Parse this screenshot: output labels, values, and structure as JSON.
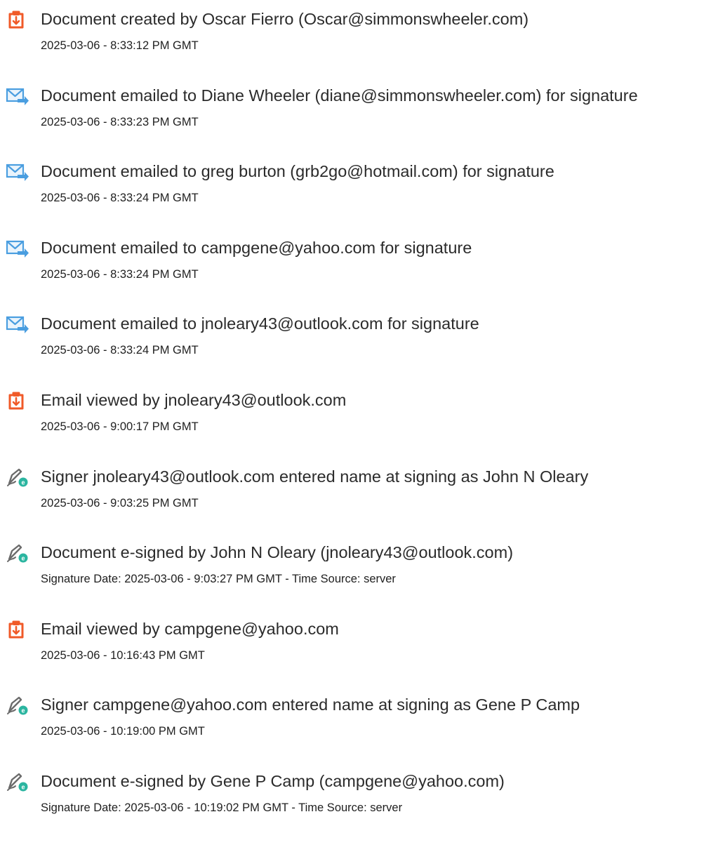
{
  "colors": {
    "created_icon": "#f05a28",
    "emailed_icon": "#4a9ee0",
    "signed_icon_pen": "#6b6b6b",
    "signed_icon_badge": "#2bb5a0",
    "text_primary": "#2b2b2b",
    "text_secondary": "#1f1f1f"
  },
  "events": [
    {
      "icon": "document-icon",
      "text": "Document created by Oscar Fierro (Oscar@simmonswheeler.com)",
      "detail": "2025-03-06 - 8:33:12 PM GMT"
    },
    {
      "icon": "email-icon",
      "text": "Document emailed to Diane Wheeler (diane@simmonswheeler.com) for signature",
      "detail": "2025-03-06 - 8:33:23 PM GMT"
    },
    {
      "icon": "email-icon",
      "text": "Document emailed to greg burton (grb2go@hotmail.com) for signature",
      "detail": "2025-03-06 - 8:33:24 PM GMT"
    },
    {
      "icon": "email-icon",
      "text": "Document emailed to campgene@yahoo.com for signature",
      "detail": "2025-03-06 - 8:33:24 PM GMT"
    },
    {
      "icon": "email-icon",
      "text": "Document emailed to jnoleary43@outlook.com for signature",
      "detail": "2025-03-06 - 8:33:24 PM GMT"
    },
    {
      "icon": "document-icon",
      "text": "Email viewed by jnoleary43@outlook.com",
      "detail": "2025-03-06 - 9:00:17 PM GMT"
    },
    {
      "icon": "esign-icon",
      "text": "Signer jnoleary43@outlook.com entered name at signing as John N Oleary",
      "detail": "2025-03-06 - 9:03:25 PM GMT"
    },
    {
      "icon": "esign-icon",
      "text": "Document e-signed by John N Oleary (jnoleary43@outlook.com)",
      "detail": "Signature Date: 2025-03-06 - 9:03:27 PM GMT - Time Source: server"
    },
    {
      "icon": "document-icon",
      "text": "Email viewed by campgene@yahoo.com",
      "detail": "2025-03-06 - 10:16:43 PM GMT"
    },
    {
      "icon": "esign-icon",
      "text": "Signer campgene@yahoo.com entered name at signing as Gene P Camp",
      "detail": "2025-03-06 - 10:19:00 PM GMT"
    },
    {
      "icon": "esign-icon",
      "text": "Document e-signed by Gene P Camp (campgene@yahoo.com)",
      "detail": "Signature Date: 2025-03-06 - 10:19:02 PM GMT - Time Source: server"
    }
  ]
}
